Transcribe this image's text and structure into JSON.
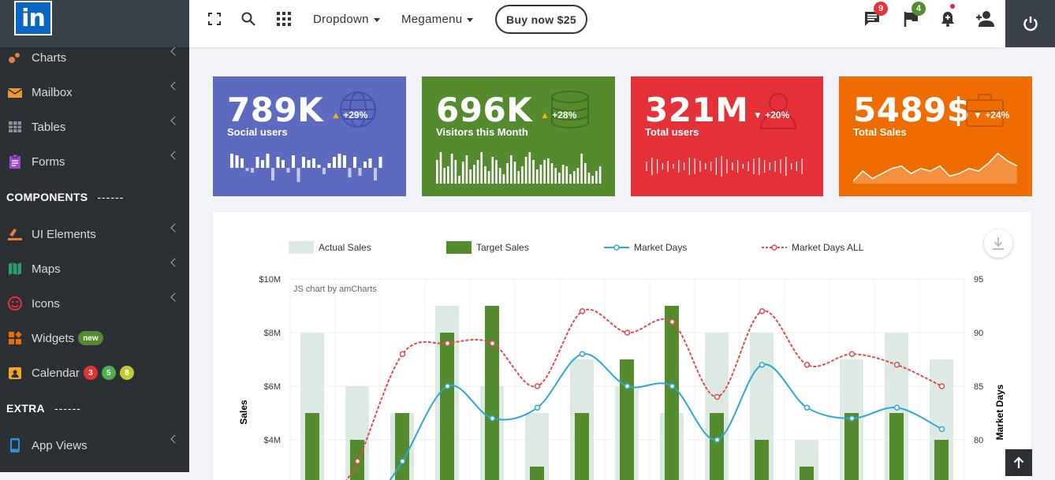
{
  "header": {
    "logo_text": "in",
    "dropdown_label": "Dropdown",
    "megamenu_label": "Megamenu",
    "buy_button": "Buy now $25",
    "messages_count": "9",
    "flags_count": "4"
  },
  "sidebar": {
    "items": [
      {
        "label": "Charts",
        "icon": "charts-icon"
      },
      {
        "label": "Mailbox",
        "icon": "mailbox-icon"
      },
      {
        "label": "Tables",
        "icon": "tables-icon"
      },
      {
        "label": "Forms",
        "icon": "forms-icon"
      }
    ],
    "components_heading": "COMPONENTS",
    "components_dash": "------",
    "components_items": [
      {
        "label": "UI Elements",
        "icon": "ui-elements-icon"
      },
      {
        "label": "Maps",
        "icon": "maps-icon"
      },
      {
        "label": "Icons",
        "icon": "smile-icon"
      },
      {
        "label": "Widgets",
        "icon": "widgets-icon",
        "badge": "new"
      },
      {
        "label": "Calendar",
        "icon": "calendar-icon",
        "badges": [
          "3",
          "5",
          "8"
        ]
      }
    ],
    "extra_heading": "EXTRA",
    "extra_dash": "------",
    "extra_items": [
      {
        "label": "App Views",
        "icon": "app-views-icon"
      }
    ]
  },
  "stats": [
    {
      "value": "789K",
      "label": "Social users",
      "delta": "+29%",
      "trend": "up",
      "color": "#5c6bc0",
      "spark": [
        18,
        16,
        12,
        4,
        6,
        14,
        10,
        18,
        16,
        14,
        10,
        6,
        16,
        18,
        14,
        10,
        12,
        4,
        8,
        6,
        14,
        18,
        16,
        12,
        14,
        10,
        8,
        12,
        16,
        14
      ]
    },
    {
      "value": "696K",
      "label": "Visitors this Month",
      "delta": "+28%",
      "trend": "up",
      "color": "#558b2f",
      "spark": [
        30,
        40,
        20,
        22,
        38,
        30,
        10,
        28,
        36,
        18,
        24,
        30,
        40,
        22,
        16,
        34,
        30,
        20,
        12,
        26,
        36,
        28,
        16,
        22,
        34,
        40,
        30,
        18,
        24,
        30,
        32,
        26,
        20,
        14,
        24,
        22,
        12,
        16,
        20,
        38,
        26,
        14,
        10,
        16,
        22
      ]
    },
    {
      "value": "321M",
      "label": "Total users",
      "delta": "+20%",
      "trend": "down",
      "color": "#e53238",
      "spark": [
        12,
        22,
        18,
        8,
        14,
        6,
        16,
        10,
        22,
        20,
        14,
        8,
        12,
        22,
        26,
        18,
        10,
        16,
        6,
        12,
        20,
        22,
        16,
        10,
        14,
        18,
        24,
        8,
        12,
        20
      ]
    },
    {
      "value": "5489$",
      "label": "Total Sales",
      "delta": "+24%",
      "trend": "down",
      "color": "#ef6c00",
      "spark": [
        2,
        10,
        4,
        8,
        12,
        14,
        8,
        12,
        10,
        14,
        6,
        8,
        12,
        10,
        16,
        24,
        18,
        14
      ]
    }
  ],
  "chart_data": {
    "type": "bar",
    "credit": "JS chart by amCharts",
    "ylabel": "Sales",
    "y2label": "Market Days",
    "y_ticks": [
      "$10M",
      "$8M",
      "$6M",
      "$4M"
    ],
    "y2_ticks": [
      "95",
      "90",
      "85",
      "80"
    ],
    "ylim": [
      2,
      10
    ],
    "y2lim": [
      75,
      95
    ],
    "series": [
      {
        "name": "Actual Sales",
        "type": "bar",
        "color": "#dde9e3",
        "values": [
          8,
          6,
          5,
          9,
          6,
          5,
          7,
          6,
          5,
          8,
          8,
          4,
          7,
          8,
          7
        ]
      },
      {
        "name": "Target Sales",
        "type": "bar",
        "color": "#558b2f",
        "values": [
          5,
          4,
          5,
          8,
          9,
          3,
          5,
          7,
          9,
          5,
          4,
          3,
          5,
          5,
          4
        ]
      },
      {
        "name": "Market Days",
        "type": "line",
        "color": "#29a9d4",
        "values": [
          null,
          null,
          78,
          85,
          82,
          83,
          88,
          85,
          85,
          80,
          87,
          83,
          82,
          83,
          81
        ]
      },
      {
        "name": "Market Days ALL",
        "type": "line",
        "color": "#e04b4b",
        "dashed": true,
        "values": [
          null,
          78,
          88,
          89,
          89,
          85,
          92,
          90,
          91,
          84,
          92,
          87,
          88,
          87,
          85
        ]
      }
    ]
  }
}
